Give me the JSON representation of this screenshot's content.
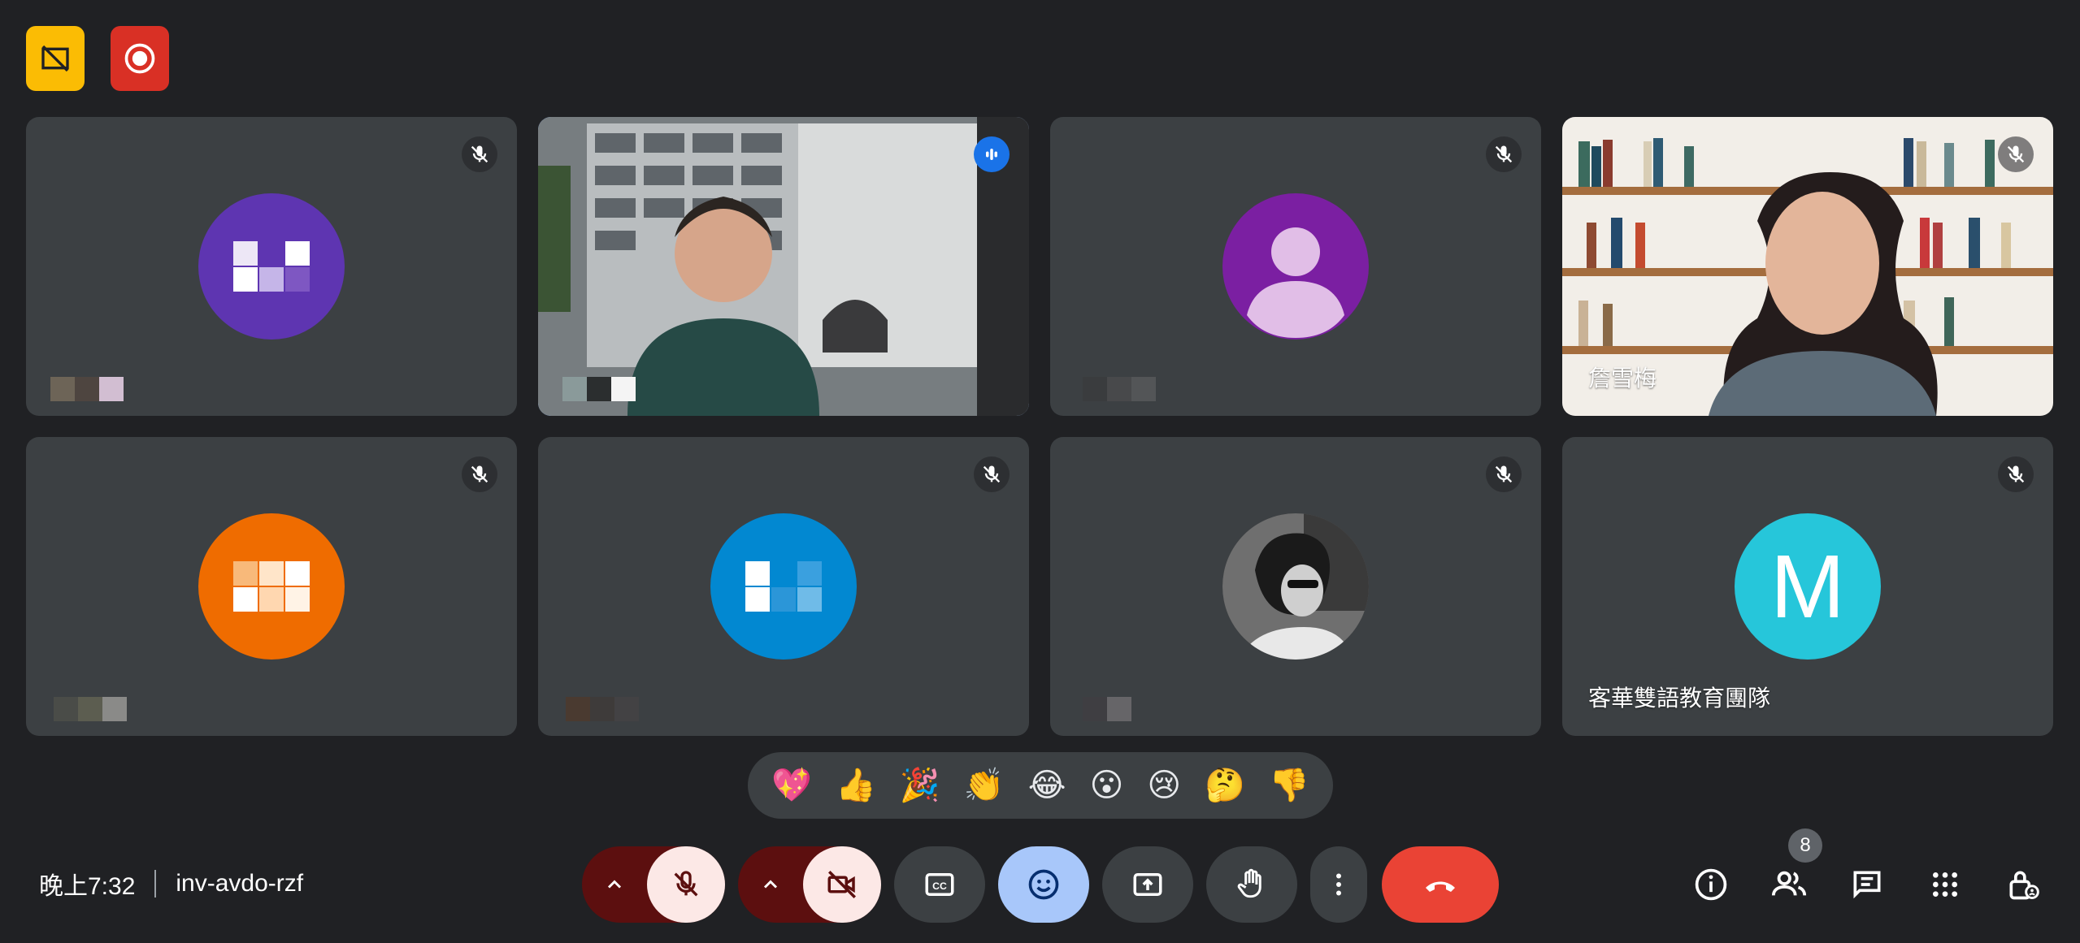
{
  "top_buttons": [
    {
      "icon": "closed-caption-off-icon",
      "color": "#fbbc04"
    },
    {
      "icon": "record-icon",
      "color": "#d93025"
    }
  ],
  "participants": [
    {
      "name": "",
      "avatar_type": "pixelated",
      "avatar_color": "#5e35b1",
      "muted": true
    },
    {
      "name": "",
      "avatar_type": "video",
      "muted": false,
      "speaking": true
    },
    {
      "name": "",
      "avatar_type": "person-placeholder",
      "avatar_color": "#7b1fa2",
      "muted": true
    },
    {
      "name": "詹雪梅",
      "avatar_type": "video",
      "muted": true
    },
    {
      "name": "",
      "avatar_type": "pixelated",
      "avatar_color": "#ef6c00",
      "muted": true
    },
    {
      "name": "",
      "avatar_type": "pixelated",
      "avatar_color": "#0288d1",
      "muted": true
    },
    {
      "name": "",
      "avatar_type": "photo",
      "muted": true
    },
    {
      "name": "客華雙語教育團隊",
      "avatar_type": "letter",
      "avatar_letter": "M",
      "avatar_color": "#26c6da",
      "muted": true
    }
  ],
  "reactions": [
    "💖",
    "👍",
    "🎉",
    "👏",
    "😂",
    "😮",
    "😢",
    "🤔",
    "👎"
  ],
  "meeting": {
    "time": "晚上7:32",
    "code": "inv-avdo-rzf"
  },
  "controls": {
    "mic_icon": "mic-off-icon",
    "camera_icon": "videocam-off-icon",
    "captions_icon": "closed-caption-icon",
    "emoji_icon": "emoji-icon",
    "present_icon": "present-icon",
    "hand_icon": "raise-hand-icon",
    "more_icon": "more-vert-icon",
    "end_call_icon": "call-end-icon"
  },
  "side_controls": {
    "participants_count": "8"
  },
  "colors": {
    "background": "#202124",
    "tile": "#3c4043",
    "end_call": "#ea4335",
    "mic_bg": "#fce8e6",
    "emoji_active": "#a8c7fa"
  }
}
